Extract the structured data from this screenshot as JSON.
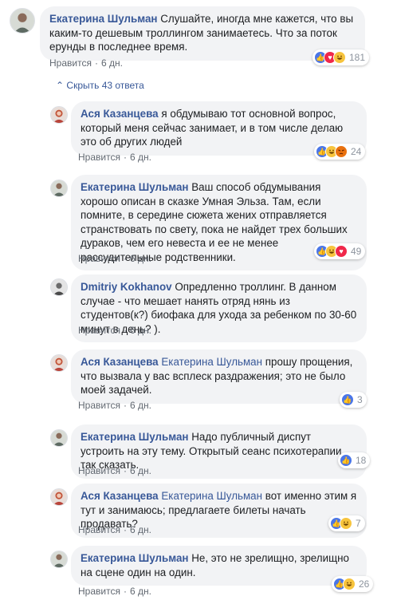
{
  "reactions_icons": {
    "like": "like-icon",
    "haha": "haha-icon",
    "love": "love-icon",
    "angry": "angry-icon"
  },
  "main_comment": {
    "author": "Екатерина Шульман",
    "text": "Слушайте, иногда мне кажется, что вы каким-то дешевым троллингом занимаетесь. Что за поток ерунды в последнее время.",
    "like_label": "Нравится",
    "time": "6 дн.",
    "reaction_count": "181"
  },
  "toggle": {
    "label": "Скрыть 43 ответа"
  },
  "replies": [
    {
      "author": "Ася Казанцева",
      "mention": "",
      "text": "я обдумываю тот основной вопрос, который меня сейчас занимает, и в том числе делаю это об других людей",
      "like_label": "Нравится",
      "time": "6 дн.",
      "reaction_count": "24"
    },
    {
      "author": "Екатерина Шульман",
      "mention": "",
      "text": "Ваш способ обдумывания хорошо описан в сказке Умная Эльза. Там, если помните, в середине сюжета жених отправляется странствовать по свету, пока не найдет трех больших дураков, чем его невеста и ее не менее рассудительные родственники.",
      "like_label": "Нравится",
      "time": "6 дн.",
      "reaction_count": "49"
    },
    {
      "author": "Dmitriy Kokhanov",
      "mention": "",
      "text": "Опредленно троллинг. В данном случае - что мешает нанять отряд нянь из студентов(к?) биофака для ухода за ребенком по 30-60 минут в день? ).",
      "like_label": "Нравится",
      "time": "6 дн.",
      "reaction_count": ""
    },
    {
      "author": "Ася Казанцева",
      "mention": "Екатерина Шульман",
      "text": "прошу прощения, что вызвала у вас всплеск раздражения; это не было моей задачей.",
      "like_label": "Нравится",
      "time": "6 дн.",
      "reaction_count": "3"
    },
    {
      "author": "Екатерина Шульман",
      "mention": "",
      "text": "Надо публичный диспут устроить на эту тему. Открытый сеанс психотерапии, так сказать.",
      "like_label": "Нравится",
      "time": "6 дн.",
      "reaction_count": "18"
    },
    {
      "author": "Ася Казанцева",
      "mention": "Екатерина Шульман",
      "text": "вот именно этим я тут и занимаюсь; предлагаете билеты начать продавать?",
      "like_label": "Нравится",
      "time": "6 дн.",
      "reaction_count": "7"
    },
    {
      "author": "Екатерина Шульман",
      "mention": "",
      "text": "Не, это не зрелищно, зрелищно на сцене один на один.",
      "like_label": "Нравится",
      "time": "6 дн.",
      "reaction_count": "26"
    }
  ]
}
